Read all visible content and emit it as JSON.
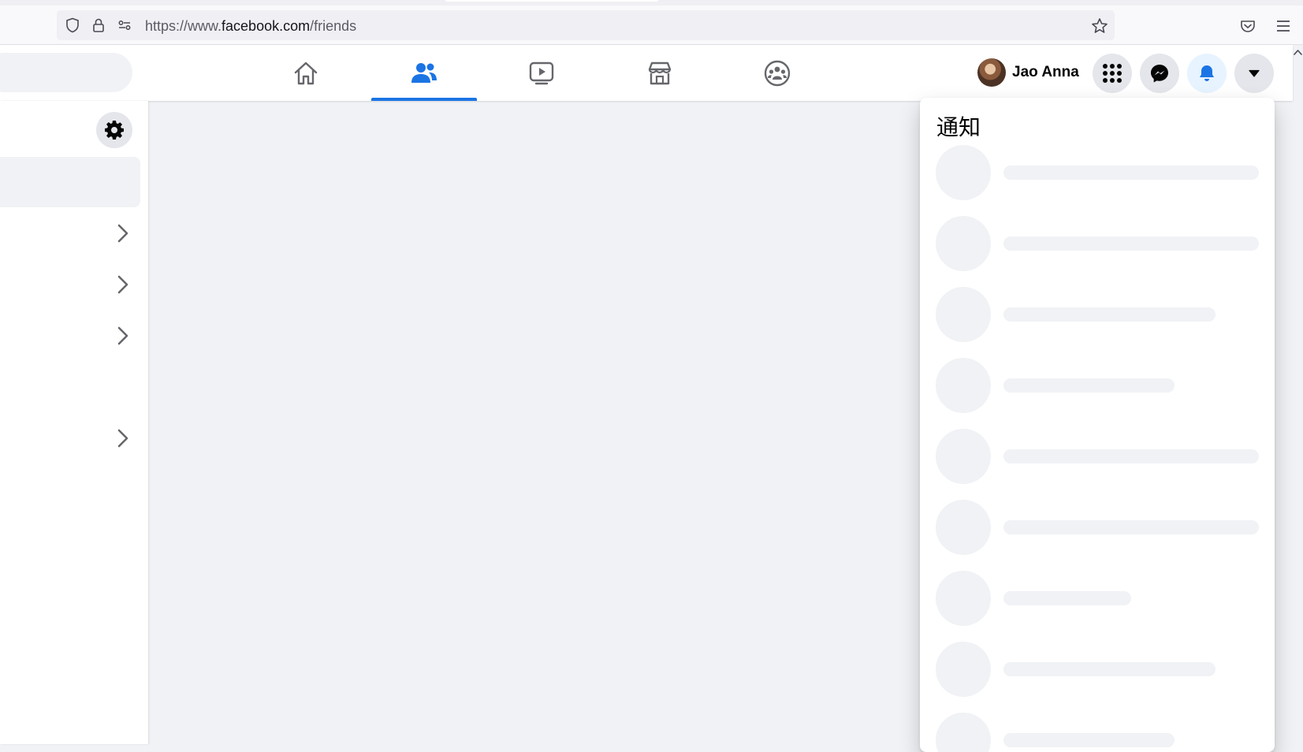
{
  "browser": {
    "url_prefix": "https://www.",
    "url_host": "facebook.com",
    "url_path": "/friends"
  },
  "header": {
    "nav_tabs": [
      {
        "name": "home",
        "icon": "home-icon",
        "active": false
      },
      {
        "name": "friends",
        "icon": "friends-icon",
        "active": true
      },
      {
        "name": "watch",
        "icon": "video-icon",
        "active": false
      },
      {
        "name": "marketplace",
        "icon": "store-icon",
        "active": false
      },
      {
        "name": "groups",
        "icon": "groups-icon",
        "active": false
      }
    ],
    "profile_name": "Jao Anna",
    "buttons": [
      {
        "name": "menu",
        "icon": "grid-icon"
      },
      {
        "name": "messenger",
        "icon": "messenger-icon"
      },
      {
        "name": "notifications",
        "icon": "bell-icon",
        "active": true
      },
      {
        "name": "account",
        "icon": "caret-down-icon"
      }
    ]
  },
  "notifications": {
    "title": "通知",
    "skeleton_rows": [
      0.82,
      0.82,
      0.68,
      0.55,
      0.82,
      0.82,
      0.41,
      0.68,
      0.55
    ]
  },
  "colors": {
    "accent": "#1b74e4",
    "skeleton": "#f0f2f5",
    "background": "#f0f2f5"
  }
}
